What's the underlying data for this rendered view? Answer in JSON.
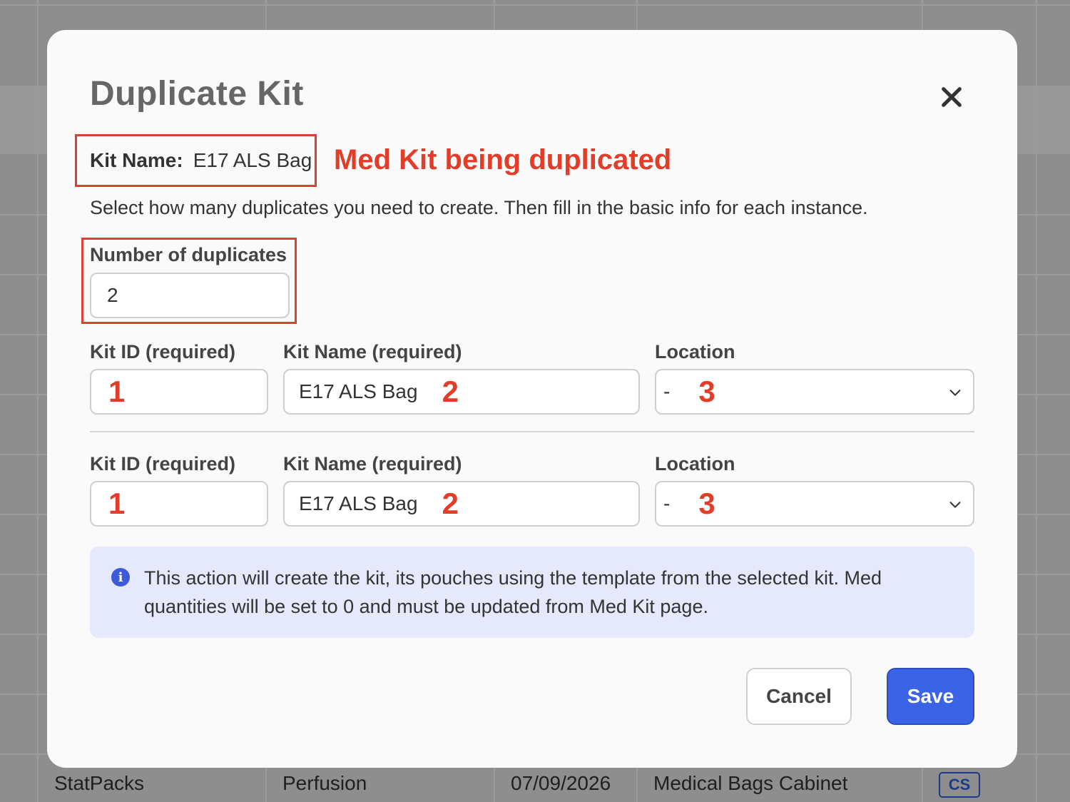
{
  "background_table": {
    "row": [
      "StatPacks",
      "Perfusion",
      "07/09/2026",
      "Medical Bags Cabinet"
    ],
    "tag": "CS"
  },
  "modal": {
    "title": "Duplicate Kit",
    "kit_name_label": "Kit Name:",
    "kit_name_value": "E17 ALS Bag",
    "annotation": "Med Kit being duplicated",
    "description": "Select how many duplicates you need to create. Then fill in the basic info for each instance.",
    "num_duplicates_label": "Number of duplicates",
    "num_duplicates_value": "2",
    "instances": [
      {
        "kit_id_label": "Kit ID (required)",
        "kit_id_value": "",
        "kit_id_marker": "1",
        "kit_name_label": "Kit Name (required)",
        "kit_name_value": "E17 ALS Bag",
        "kit_name_marker": "2",
        "location_label": "Location",
        "location_value": "-",
        "location_marker": "3"
      },
      {
        "kit_id_label": "Kit ID (required)",
        "kit_id_value": "",
        "kit_id_marker": "1",
        "kit_name_label": "Kit Name (required)",
        "kit_name_value": "E17 ALS Bag",
        "kit_name_marker": "2",
        "location_label": "Location",
        "location_value": "-",
        "location_marker": "3"
      }
    ],
    "info_text": "This action will create the kit, its pouches using the template from the selected kit. Med quantities will be set to 0 and must be updated from Med Kit page.",
    "cancel_label": "Cancel",
    "save_label": "Save"
  },
  "colors": {
    "annotation_red": "#e23d28",
    "primary_blue": "#3b63e6",
    "info_bg": "#e6e9fb"
  },
  "icons": [
    "close-icon",
    "chevron-down-icon",
    "info-icon"
  ]
}
